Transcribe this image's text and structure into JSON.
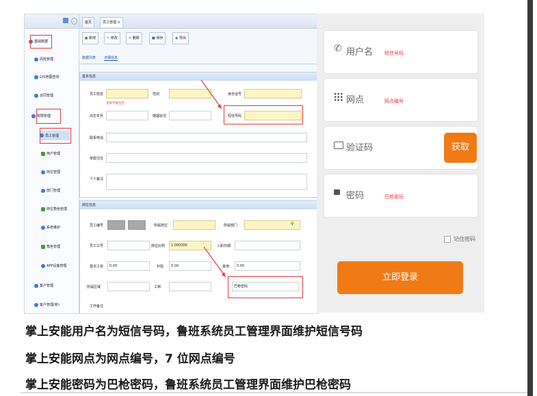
{
  "admin": {
    "tree_items": [
      {
        "label": "基础数据"
      },
      {
        "label": "风险管理"
      },
      {
        "label": "GIS地图查询"
      },
      {
        "label": "合同管理"
      },
      {
        "label": "权限管理"
      },
      {
        "label": "员工管理"
      },
      {
        "label": "用户管理"
      },
      {
        "label": "岗位管理"
      },
      {
        "label": "部门管理"
      },
      {
        "label": "岗位角色管理"
      },
      {
        "label": "系统维护"
      },
      {
        "label": "角色管理"
      },
      {
        "label": "APP设备管理"
      },
      {
        "label": "客户管理"
      },
      {
        "label": "客户管理(新)"
      }
    ],
    "tabs": [
      "首页",
      "员工管理 ×"
    ],
    "toolbar": [
      "新增",
      "修改",
      "删除",
      "保存",
      "导出"
    ],
    "subtabs": [
      "数据列表",
      "详细信息"
    ],
    "basic_section": {
      "title": "基本信息",
      "fields": {
        "name": "员工姓名",
        "gender": "性别",
        "address": "住址地址",
        "id_card": "身份证号",
        "must_fill": "名称不能为空",
        "birth": "出生年月",
        "marital": "婚姻状况",
        "sms_number": "短信号码",
        "contact": "联系电话",
        "home": "家庭住址",
        "remark": "个人备注"
      }
    },
    "job_section": {
      "title": "岗位信息",
      "fields": {
        "emp_id": "员工编号",
        "post": "所属岗位",
        "dept": "所属部门",
        "emp_no": "员工工号",
        "ratio": "岗位比例",
        "ratio_value": "1.000000",
        "entry_date": "入职日期",
        "base_salary": "基本工资",
        "base_salary_value": "0.00",
        "subsidy": "补贴",
        "subsidy_value": "0.00",
        "other": "其他",
        "other_value": "0.00",
        "region": "所属区域",
        "work_type": "工种",
        "gun_password": "巴枪密码",
        "work_remark": "工作备注"
      }
    }
  },
  "login": {
    "username": {
      "label": "用户名",
      "hint": "短信号码"
    },
    "branch": {
      "label": "网点",
      "hint": "网点编号"
    },
    "code": {
      "label": "验证码",
      "button": "获取"
    },
    "password": {
      "label": "密码",
      "hint": "巴枪密码"
    },
    "remember": "记住密码",
    "login_button": "立即登录"
  },
  "captions": [
    "掌上安能用户名为短信号码，鲁班系统员工管理界面维护短信号码",
    "掌上安能网点为网点编号，7 位网点编号",
    "掌上安能密码为巴枪密码，鲁班系统员工管理界面维护巴枪密码"
  ],
  "colors": {
    "accent": "#f07b16",
    "highlight_red": "#e0393e",
    "field_yellow": "#fdf6c4"
  }
}
